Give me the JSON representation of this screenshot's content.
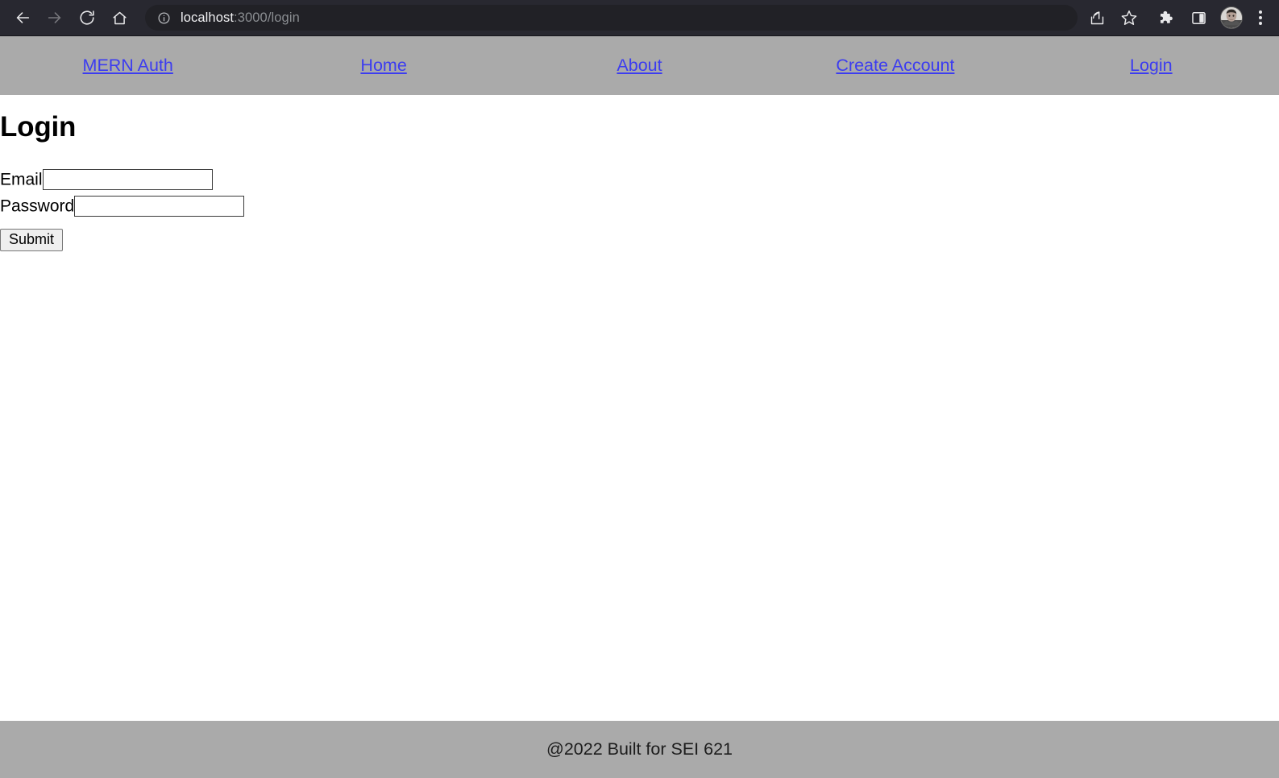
{
  "browser": {
    "back_label": "Back",
    "forward_label": "Forward",
    "reload_label": "Reload",
    "home_label": "Home",
    "site_info_label": "View site information",
    "url_host": "localhost",
    "url_path": ":3000/login",
    "share_label": "Share this page",
    "bookmark_label": "Bookmark this tab",
    "extensions_label": "Extensions",
    "side_panel_label": "Side panel",
    "profile_label": "Profile",
    "menu_label": "Customize and control Google Chrome"
  },
  "site_nav": {
    "links": [
      {
        "label": "MERN Auth"
      },
      {
        "label": "Home"
      },
      {
        "label": "About"
      },
      {
        "label": "Create Account"
      },
      {
        "label": "Login"
      }
    ]
  },
  "main": {
    "title": "Login",
    "form": {
      "email": {
        "label": "Email",
        "value": "",
        "placeholder": ""
      },
      "password": {
        "label": "Password",
        "value": "",
        "placeholder": ""
      },
      "submit_label": "Submit"
    }
  },
  "footer": {
    "text": "@2022 Built for SEI 621"
  },
  "colors": {
    "chrome_bg": "#282830",
    "omnibox_bg": "#212126",
    "nav_bg": "#aaaaaa",
    "footer_bg": "#aaaaaa",
    "link": "#3c3cf0",
    "page_bg": "#ffffff"
  }
}
